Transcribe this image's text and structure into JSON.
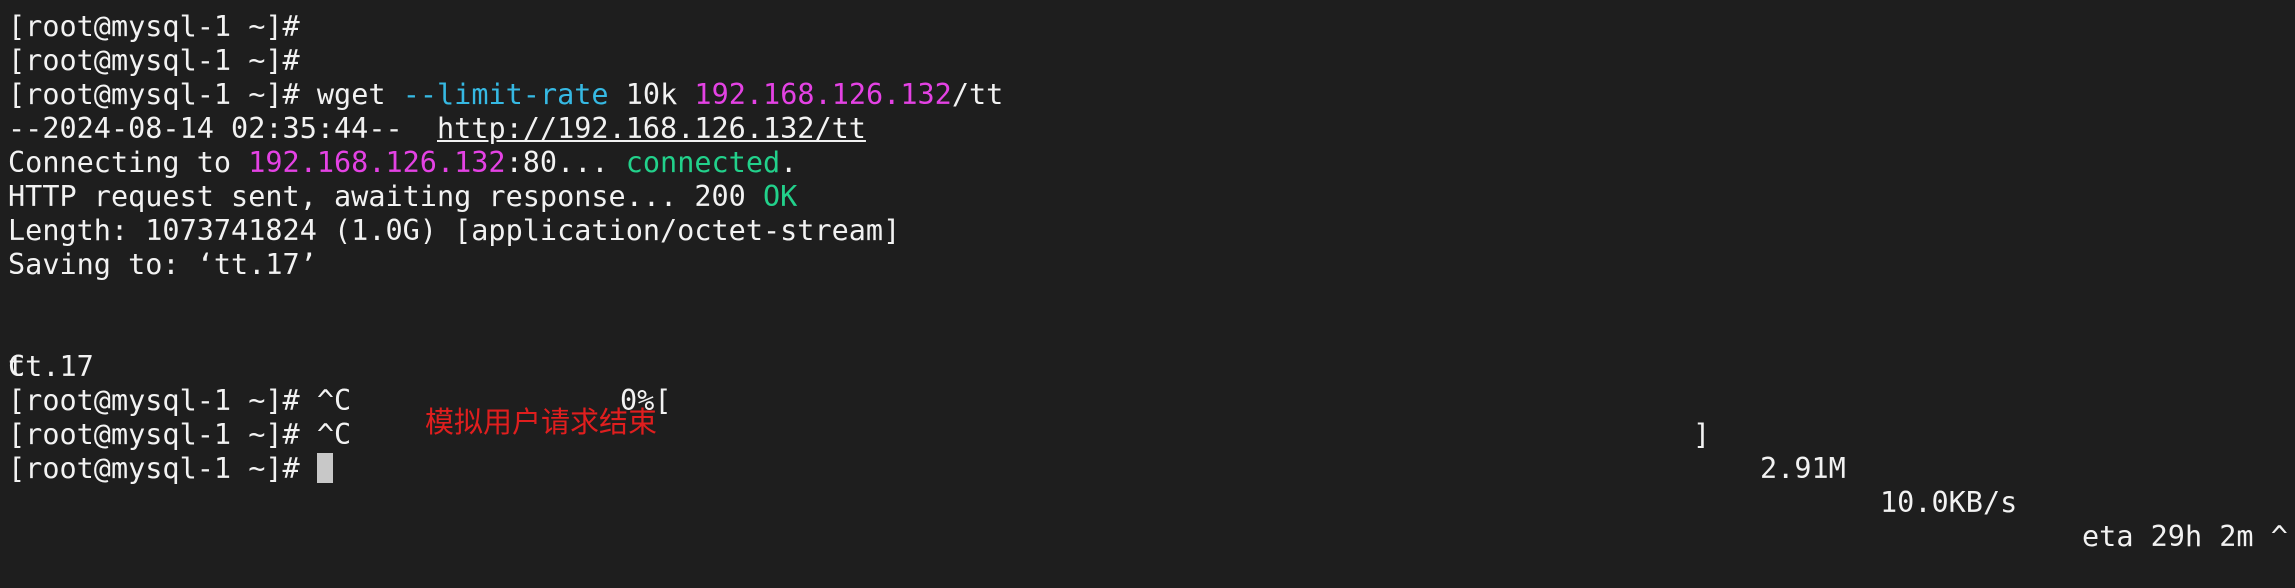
{
  "terminal": {
    "prompt": "[root@mysql-1 ~]#",
    "cmd": {
      "program": "wget",
      "option": "--limit-rate",
      "rate": "10k",
      "host": "192.168.126.132",
      "path": "/tt"
    },
    "output": {
      "timestamp": "--2024-08-14 02:35:44--",
      "url": "http://192.168.126.132/tt",
      "connecting_prefix": "Connecting to ",
      "connecting_host": "192.168.126.132",
      "connecting_port": ":80",
      "connecting_dots": "... ",
      "connected": "connected",
      "connected_period": ".",
      "http_text": "HTTP request sent, awaiting response... 200 ",
      "http_ok": "OK",
      "length": "Length: 1073741824 (1.0G) [application/octet-stream]",
      "saving": "Saving to: ‘tt.17’"
    },
    "progress": {
      "filename": "tt.17",
      "percent": "0%[",
      "bar_end": "]",
      "downloaded": "2.91M",
      "speed": "10.0KB/s",
      "eta": "eta 29h 2m ^",
      "wrap": "C"
    },
    "interrupt": "^C"
  },
  "annotation": {
    "text": "模拟用户请求结束",
    "color": "#e01e1e"
  },
  "colors": {
    "background": "#1e1e1e",
    "text": "#f2f2f2",
    "ip": "#e442e4",
    "option": "#36b9e3",
    "ok": "#22d18b"
  }
}
